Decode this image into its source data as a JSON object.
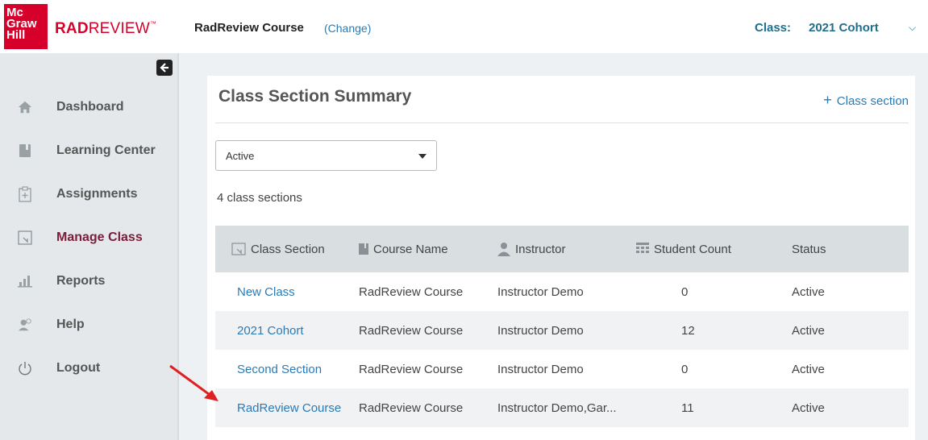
{
  "header": {
    "mh_logo": [
      "Mc",
      "Graw",
      "Hill"
    ],
    "brand_rad": "RAD",
    "brand_review": "REVIEW",
    "brand_tm": "™",
    "course_title": "RadReview Course",
    "course_change": "(Change)",
    "class_label": "Class:",
    "class_value": "2021 Cohort",
    "class_chevron": "⌵"
  },
  "sidebar": {
    "collapse_icon": "arrow-left-icon",
    "items": [
      {
        "label": "Dashboard",
        "icon": "home-icon"
      },
      {
        "label": "Learning Center",
        "icon": "book-icon"
      },
      {
        "label": "Assignments",
        "icon": "clipboard-plus-icon"
      },
      {
        "label": "Manage Class",
        "icon": "manage-class-icon",
        "active": true
      },
      {
        "label": "Reports",
        "icon": "bar-chart-icon"
      },
      {
        "label": "Help",
        "icon": "help-user-icon"
      },
      {
        "label": "Logout",
        "icon": "power-icon"
      }
    ]
  },
  "main": {
    "title": "Class Section Summary",
    "add_section_plus": "+",
    "add_section_label": "Class section",
    "filter_value": "Active",
    "count_text": "4 class sections",
    "columns": [
      "Class Section",
      "Course Name",
      "Instructor",
      "Student Count",
      "Status"
    ],
    "rows": [
      {
        "section": "New Class",
        "course": "RadReview Course",
        "instructor": "Instructor Demo",
        "count": "0",
        "status": "Active"
      },
      {
        "section": "2021 Cohort",
        "course": "RadReview Course",
        "instructor": "Instructor Demo",
        "count": "12",
        "status": "Active"
      },
      {
        "section": "Second Section",
        "course": "RadReview Course",
        "instructor": "Instructor Demo",
        "count": "0",
        "status": "Active"
      },
      {
        "section": "RadReview Course",
        "course": "RadReview Course",
        "instructor": "Instructor Demo,Gar...",
        "count": "11",
        "status": "Active"
      }
    ]
  },
  "colors": {
    "brand_red": "#d6002a",
    "link_blue": "#2a7bb5",
    "class_teal": "#1f6f8b",
    "active_nav": "#7b1d3a",
    "arrow_red": "#e02020"
  }
}
